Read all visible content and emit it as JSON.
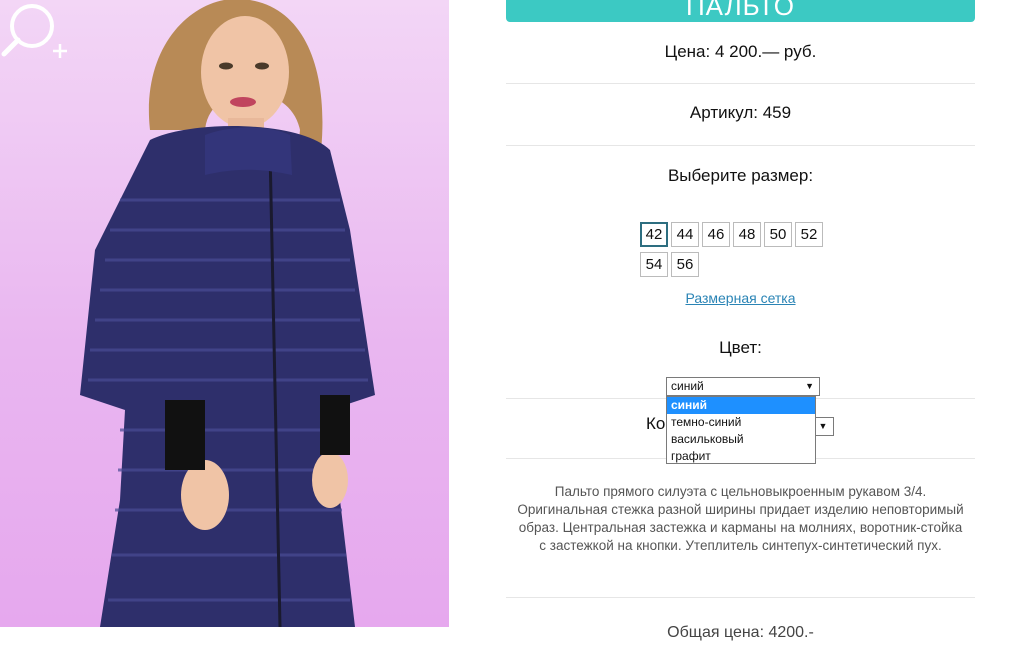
{
  "product": {
    "title": "ПАЛЬТО",
    "price": "Цена: 4 200.— руб.",
    "article": "Артикул: 459"
  },
  "sizes": {
    "label": "Выберите размер:",
    "options": [
      "42",
      "44",
      "46",
      "48",
      "50",
      "52",
      "54",
      "56"
    ],
    "selected": "42",
    "chart_link": "Размерная сетка"
  },
  "color": {
    "label": "Цвет:",
    "selected": "синий",
    "options": [
      "синий",
      "темно-синий",
      "васильковый",
      "графит"
    ]
  },
  "quantity": {
    "label": "Ко"
  },
  "description": {
    "text": "Пальто прямого силуэта с цельновыкроенным рукавом 3/4. Оригинальная стежка разной ширины придает изделию неповторимый образ. Центральная застежка и карманы на молниях, воротник-стойка с застежкой на кнопки. Утеплитель синтепух-синтетический пух."
  },
  "total": {
    "text": "Общая цена: 4200.-"
  },
  "icons": {
    "zoom": "zoom-in-icon",
    "arrow": "chevron-down-icon"
  },
  "colors": {
    "accent": "#3cc9c3",
    "link": "#2a84b5",
    "option_highlight": "#1e90ff"
  }
}
